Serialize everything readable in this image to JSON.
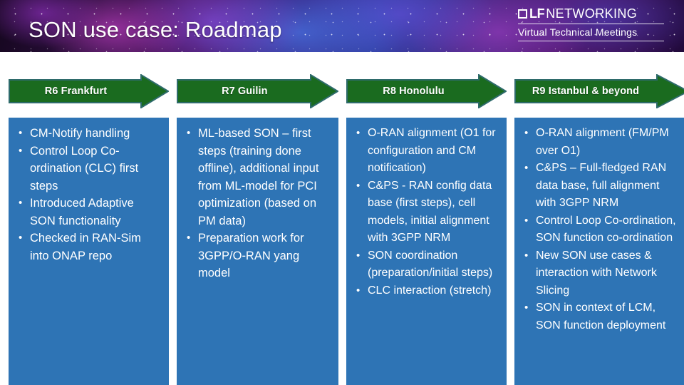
{
  "header": {
    "title": "SON use case: Roadmap",
    "logo": {
      "mark_icon": "lf-square-icon",
      "brand_bold": "LF",
      "brand_rest": "NETWORKING",
      "subtitle": "Virtual Technical Meetings"
    }
  },
  "colors": {
    "arrow_fill": "#1a6b1f",
    "arrow_stroke": "#2e6b6b",
    "panel_fill": "#2e74b5",
    "title_text": "#ffffff"
  },
  "columns": [
    {
      "arrow_label": "R6 Frankfurt",
      "bullets": [
        "CM-Notify handling",
        "Control Loop Co-ordination (CLC) first steps",
        "Introduced Adaptive SON functionality",
        "Checked in RAN-Sim into ONAP repo"
      ]
    },
    {
      "arrow_label": "R7 Guilin",
      "bullets": [
        "ML-based SON – first steps (training done offline), additional input from ML-model for PCI optimization (based on PM data)",
        "Preparation work for 3GPP/O-RAN yang model"
      ]
    },
    {
      "arrow_label": "R8 Honolulu",
      "bullets": [
        "O-RAN alignment (O1 for configuration and CM notification)",
        "C&PS - RAN config data base (first steps), cell models, initial alignment with 3GPP NRM",
        "SON coordination (preparation/initial steps)",
        "CLC interaction (stretch)"
      ]
    },
    {
      "arrow_label": "R9 Istanbul & beyond",
      "bullets": [
        "O-RAN alignment (FM/PM over O1)",
        "C&PS – Full-fledged RAN data base, full alignment with 3GPP NRM",
        "Control Loop Co-ordination, SON function co-ordination",
        "New SON use cases & interaction with Network Slicing",
        "SON in context of LCM, SON function deployment"
      ]
    }
  ]
}
